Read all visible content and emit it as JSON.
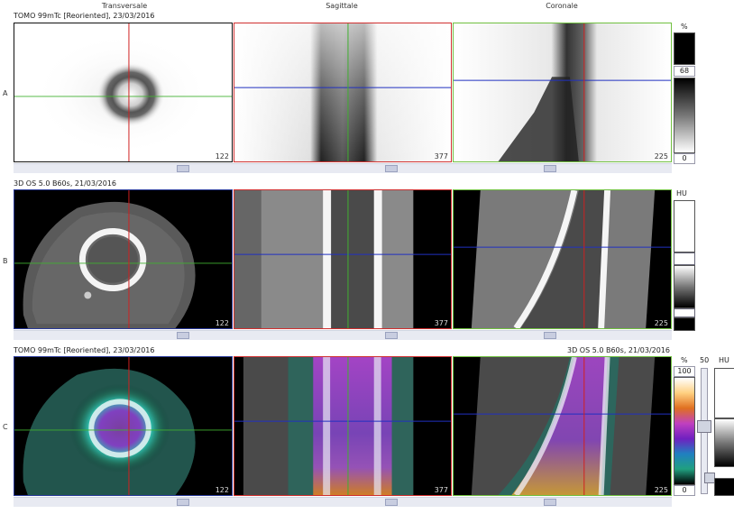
{
  "columns": {
    "transversal": "Transversale",
    "sagittal": "Sagittale",
    "coronal": "Coronale"
  },
  "rows": {
    "a": {
      "label": "A",
      "series": "TOMO 99mTc [Reoriented], 23/03/2016"
    },
    "b": {
      "label": "B",
      "series": "3D  OS  5.0  B60s, 21/03/2016"
    },
    "c": {
      "label": "C",
      "series_left": "TOMO 99mTc [Reoriented], 23/03/2016",
      "series_right": "3D  OS  5.0  B60s, 21/03/2016"
    }
  },
  "slices": {
    "transversal": "122",
    "sagittal": "377",
    "coronal": "225"
  },
  "scales": {
    "a": {
      "unit": "%",
      "level": "68",
      "min": "0"
    },
    "b": {
      "unit": "HU"
    },
    "c": {
      "unit_pet": "%",
      "max": "100",
      "min": "0",
      "blend": "50",
      "unit_ct": "HU"
    }
  },
  "colors": {
    "transversal_frame": "#000000",
    "sagittal_frame": "#d03030",
    "coronal_frame": "#70c040",
    "ct_frame": "#2a3a9a",
    "axis_red": "#d02020",
    "axis_green": "#40b030",
    "axis_blue": "#2030c0"
  }
}
